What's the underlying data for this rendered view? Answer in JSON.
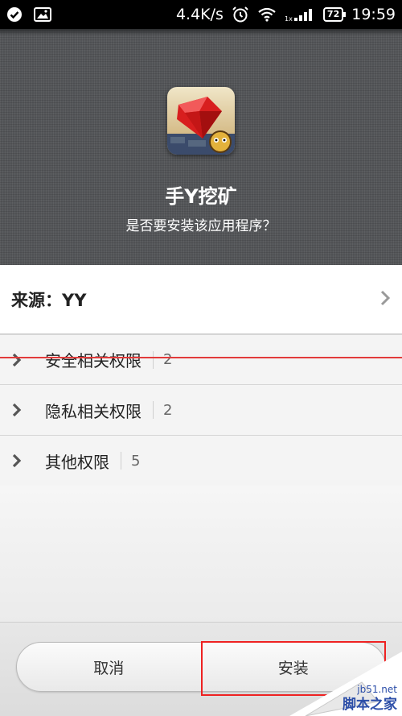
{
  "status_bar": {
    "network_speed": "4.4K/s",
    "battery": "72",
    "time": "19:59",
    "signal_label": "1x",
    "icons": [
      "check-circle-icon",
      "image-icon",
      "alarm-icon",
      "wifi-icon",
      "signal-icon",
      "battery-icon"
    ]
  },
  "app": {
    "name": "手Y挖矿",
    "question": "是否要安装该应用程序？"
  },
  "source": {
    "label": "来源：YY"
  },
  "permissions": [
    {
      "title": "安全相关权限",
      "count": "2"
    },
    {
      "title": "隐私相关权限",
      "count": "2"
    },
    {
      "title": "其他权限",
      "count": "5"
    }
  ],
  "buttons": {
    "cancel_label": "取消",
    "install_label": "安装"
  },
  "watermark": {
    "site": "jb51.net",
    "name": "脚本之家"
  },
  "colors": {
    "header_bg": "#545659",
    "annotation_red": "#e22222",
    "watermark_blue": "#2c4ea8"
  }
}
